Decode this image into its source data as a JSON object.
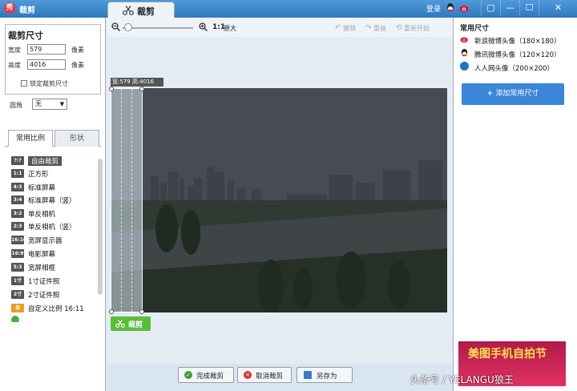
{
  "window": {
    "title": "裁剪",
    "active_tab": "裁剪",
    "login_label": "登录",
    "controls": [
      "▢",
      "—",
      "☐",
      "✕"
    ]
  },
  "size_panel": {
    "heading": "裁剪尺寸",
    "width_label": "宽度",
    "width_value": "579",
    "height_label": "高度",
    "height_value": "4016",
    "unit": "像素",
    "lock_label": "锁定裁剪尺寸",
    "corner_label": "圆角",
    "corner_value": "无"
  },
  "left_tabs": [
    "常用比例",
    "形状"
  ],
  "ratios": [
    {
      "badge": "?:?",
      "label": "自由裁剪",
      "selected": true
    },
    {
      "badge": "1:1",
      "label": "正方形"
    },
    {
      "badge": "4:3",
      "label": "标准屏幕"
    },
    {
      "badge": "3:4",
      "label": "标准屏幕（竖）"
    },
    {
      "badge": "3:2",
      "label": "单反相机"
    },
    {
      "badge": "2:3",
      "label": "单反相机（竖）"
    },
    {
      "badge": "16:10",
      "label": "宽屏显示器"
    },
    {
      "badge": "16:9",
      "label": "电影屏幕"
    },
    {
      "badge": "5:3",
      "label": "宽屏相框"
    },
    {
      "badge": "1寸",
      "label": "1寸证件照"
    },
    {
      "badge": "2寸",
      "label": "2寸证件照"
    },
    {
      "badge": "自",
      "label": "自定义比例  16:11"
    }
  ],
  "toolbar": {
    "zoom_ratio": "1:1",
    "zoom_label": "原大",
    "undo": "撤销",
    "redo": "重做",
    "restart": "重新开始"
  },
  "crop": {
    "dimension_label": "宽:579 高:4016",
    "button_label": "裁剪"
  },
  "bottom_buttons": {
    "done": "完成裁剪",
    "cancel": "取消裁剪",
    "save_as": "另存为"
  },
  "right_panel": {
    "heading": "常用尺寸",
    "presets": [
      {
        "label": "新浪微博头像（180×180）",
        "icon": "weibo-icon"
      },
      {
        "label": "腾讯微博头像（120×120）",
        "icon": "qq-icon"
      },
      {
        "label": "人人网头像（200×200）",
        "icon": "renren-icon"
      }
    ],
    "add_button": "添加常用尺寸"
  },
  "ad": {
    "text": "美图手机自拍节"
  },
  "watermark": "头条号 / YELANGU狼王"
}
